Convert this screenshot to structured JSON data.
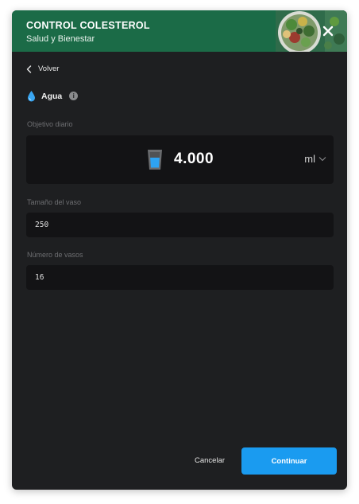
{
  "header": {
    "title": "CONTROL COLESTEROL",
    "subtitle": "Salud y Bienestar",
    "accent_color": "#1b6b47",
    "close_icon": "close-icon"
  },
  "nav": {
    "back_label": "Volver",
    "back_icon": "chevron-left-icon"
  },
  "section": {
    "title": "Agua",
    "icon": "water-drop-icon",
    "info_icon": "info-icon"
  },
  "goal": {
    "label": "Objetivo diario",
    "value": "4.000",
    "unit": "ml",
    "icon": "water-glass-icon"
  },
  "glass_size": {
    "label": "Tamaño del vaso",
    "value": "250"
  },
  "glass_count": {
    "label": "Número de vasos",
    "value": "16"
  },
  "footer": {
    "cancel_label": "Cancelar",
    "continue_label": "Continuar",
    "primary_color": "#1a9bf0"
  }
}
